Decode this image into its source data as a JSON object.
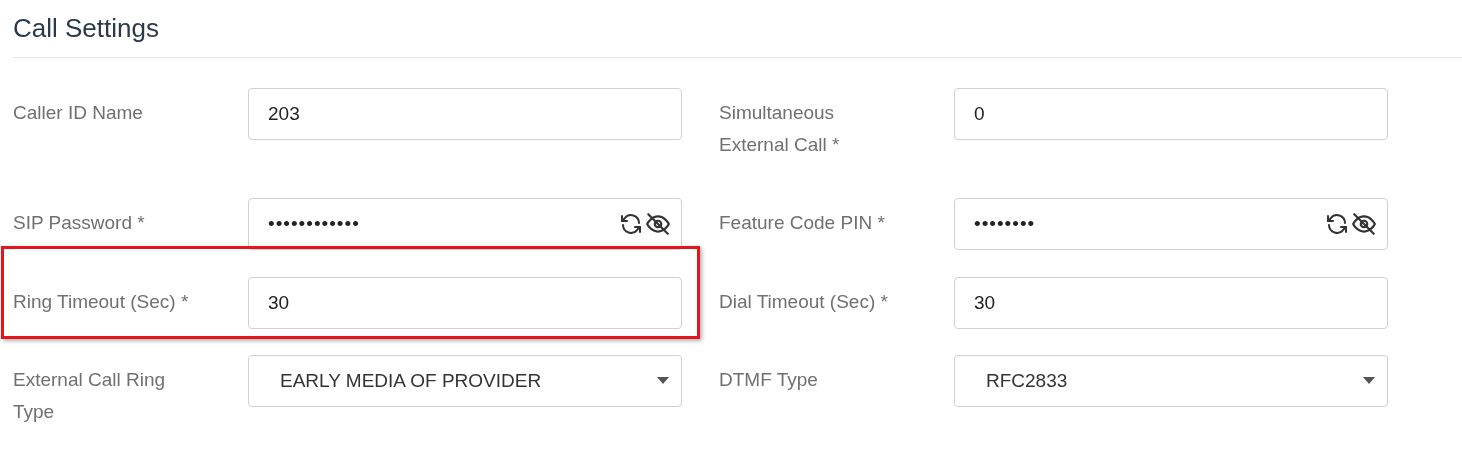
{
  "title": "Call Settings",
  "rows": [
    {
      "fields": [
        {
          "label": "Caller ID Name",
          "kind": "text",
          "value": "203",
          "highlighted": false
        },
        {
          "label": "Simultaneous External Call *",
          "kind": "text",
          "value": "0",
          "highlighted": false
        }
      ]
    },
    {
      "fields": [
        {
          "label": "SIP Password *",
          "kind": "password",
          "value": "••••••••••••",
          "highlighted": false
        },
        {
          "label": "Feature Code PIN *",
          "kind": "password",
          "value": "••••••••",
          "highlighted": false
        }
      ]
    },
    {
      "fields": [
        {
          "label": "Ring Timeout (Sec) *",
          "kind": "text",
          "value": "30",
          "highlighted": true
        },
        {
          "label": "Dial Timeout (Sec) *",
          "kind": "text",
          "value": "30",
          "highlighted": false
        }
      ]
    },
    {
      "fields": [
        {
          "label": "External Call Ring Type",
          "kind": "select",
          "value": "EARLY MEDIA OF PROVIDER",
          "highlighted": false
        },
        {
          "label": "DTMF Type",
          "kind": "select",
          "value": "RFC2833",
          "highlighted": false
        }
      ]
    }
  ]
}
